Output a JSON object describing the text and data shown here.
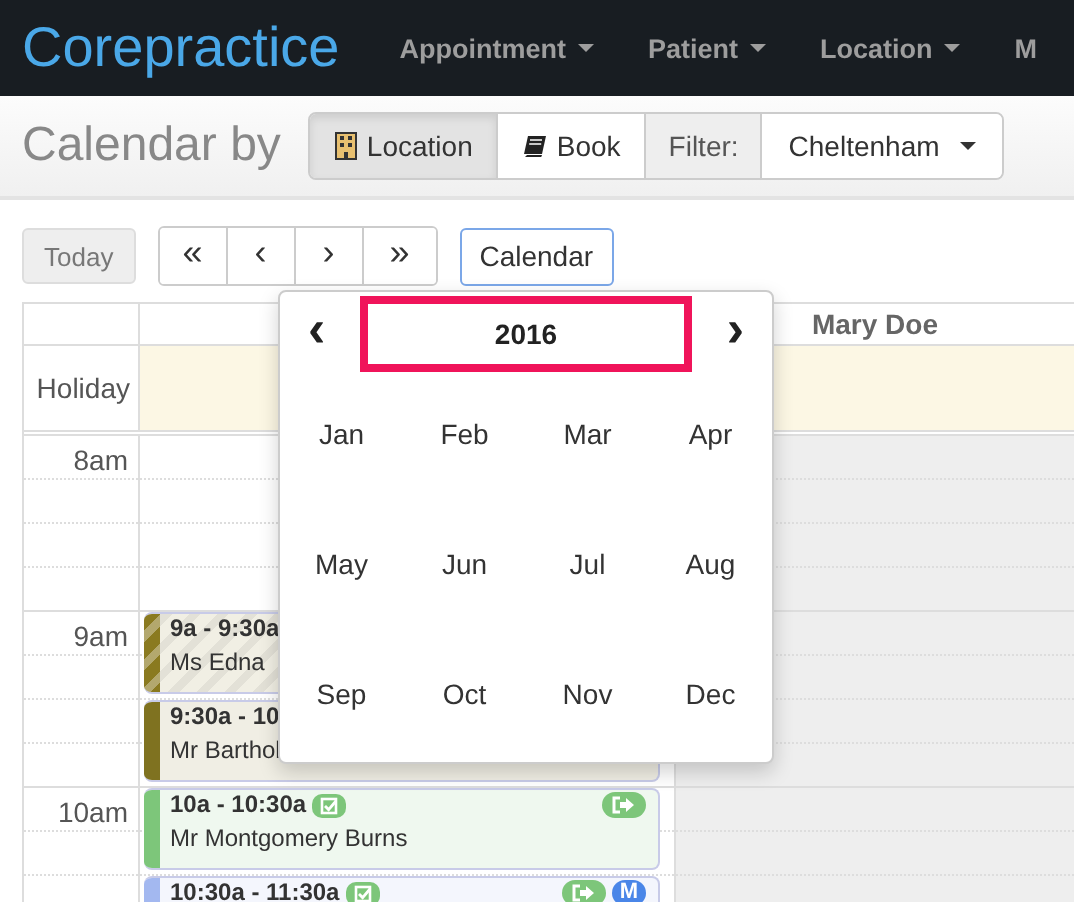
{
  "navbar": {
    "brand": "Corepractice",
    "menus": [
      {
        "label": "Appointment",
        "caret": true
      },
      {
        "label": "Patient",
        "caret": true
      },
      {
        "label": "Location",
        "caret": true
      },
      {
        "label": "M",
        "caret": false
      }
    ]
  },
  "toolbar": {
    "title": "Calendar by",
    "views": [
      {
        "label": "Location",
        "selected": true
      },
      {
        "label": "Book",
        "selected": false
      }
    ],
    "filter_label": "Filter:",
    "filter_value": "Cheltenham"
  },
  "nav": {
    "today": {
      "label": "Today",
      "disabled": true
    },
    "buttons": [
      "«",
      "‹",
      "›",
      "»"
    ],
    "calendar": "Calendar"
  },
  "calendar": {
    "columns": [
      {
        "available": true
      },
      {
        "name": "Mary Doe",
        "available": false
      }
    ],
    "holiday_label": "Holiday",
    "hours": [
      "8am",
      "9am",
      "10am"
    ],
    "events": [
      {
        "time": "9a - 9:30a",
        "name": "Ms Edna",
        "color": "#8a7a20",
        "striped": true
      },
      {
        "time": "9:30a - 10",
        "name": "Mr Barthol",
        "color": "#7f7220",
        "striped": false
      },
      {
        "time": "10a - 10:30a",
        "name": "Mr Montgomery Burns",
        "color": "#7dc67a",
        "striped": false,
        "badges": [
          {
            "kind": "check"
          },
          {
            "kind": "exit"
          }
        ]
      },
      {
        "time": "10:30a - 11:30a",
        "color": "#a3b8f0",
        "striped": false,
        "badges": [
          {
            "kind": "check"
          },
          {
            "kind": "exit"
          },
          {
            "kind": "letter",
            "text": "M"
          }
        ]
      }
    ]
  },
  "month_picker": {
    "prev": "‹",
    "next": "›",
    "year": "2016",
    "year_highlighted": true,
    "months": [
      "Jan",
      "Feb",
      "Mar",
      "Apr",
      "May",
      "Jun",
      "Jul",
      "Aug",
      "Sep",
      "Oct",
      "Nov",
      "Dec"
    ]
  }
}
